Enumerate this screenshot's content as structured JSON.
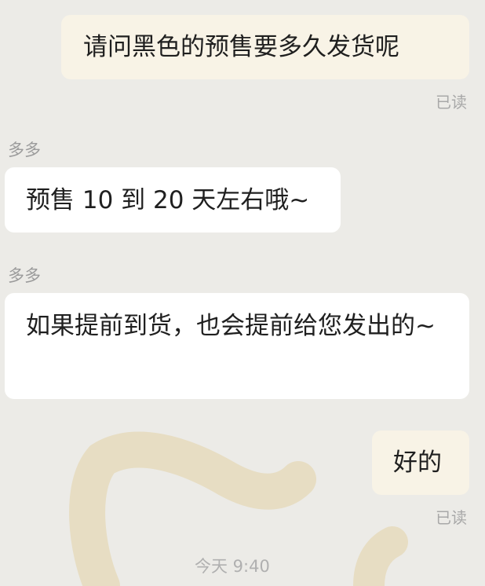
{
  "chat": {
    "messages": [
      {
        "direction": "out",
        "text": "请问黑色的预售要多久发货呢",
        "status": "已读"
      },
      {
        "direction": "in",
        "sender": "多多",
        "text": "预售 10 到 20 天左右哦~"
      },
      {
        "direction": "in",
        "sender": "多多",
        "text": "如果提前到货，也会提前给您发出的~"
      },
      {
        "direction": "out",
        "text": "好的",
        "status": "已读"
      }
    ],
    "timestamp": "今天 9:40"
  },
  "colors": {
    "background": "#ecebe7",
    "outgoing_bubble": "#f8f3e6",
    "incoming_bubble": "#ffffff",
    "watermark": "#e6dcc1"
  }
}
